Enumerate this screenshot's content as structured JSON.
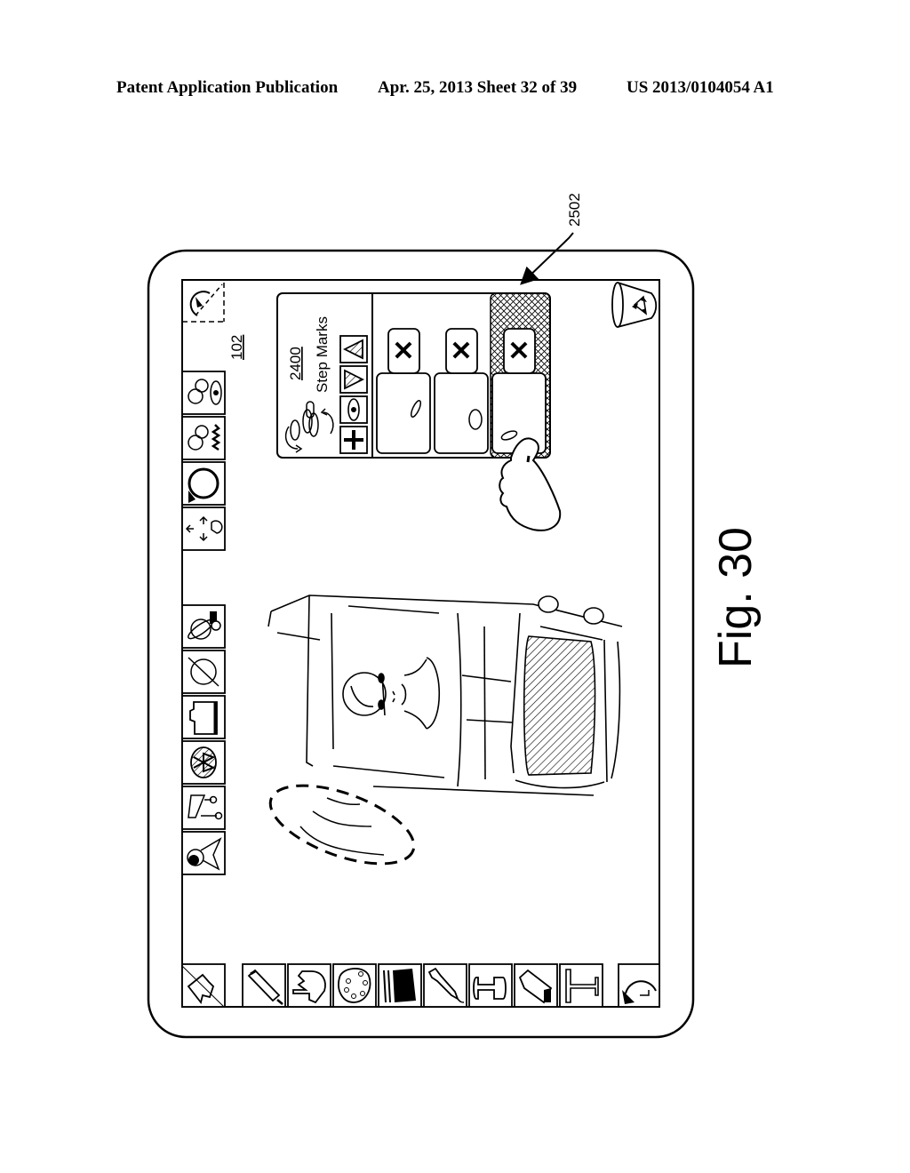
{
  "header": {
    "left": "Patent Application Publication",
    "middle": "Apr. 25, 2013  Sheet 32 of 39",
    "right": "US 2013/0104054 A1"
  },
  "figure": {
    "label": "Fig. 30",
    "device_ref": "102",
    "callout_ref": "2502"
  },
  "step_marks_panel": {
    "ref": "2400",
    "title": "Step Marks",
    "controls": [
      "move-up-icon",
      "move-down-icon",
      "eye-visibility-icon",
      "add-plus-icon"
    ],
    "steps": [
      {
        "delete_label": "✕",
        "selected": false
      },
      {
        "delete_label": "✕",
        "selected": false
      },
      {
        "delete_label": "✕",
        "selected": true
      }
    ]
  },
  "left_toolbar": {
    "top_items": [
      "rotate-corner-icon",
      "chat-eye-icon",
      "chat-crowd-icon",
      "circle-arrow-icon",
      "move-arrows-icon"
    ],
    "bottom_items": [
      "globe-camera-icon",
      "globe-icon",
      "folder-icon",
      "bluetooth-icon",
      "share-link-icon",
      "paint-target-icon"
    ]
  },
  "bottom_toolbar": {
    "items": [
      "ruler-icon",
      "marker-icon",
      "hand-smudge-icon",
      "palette-icon",
      "fill-swatch-icon",
      "eyedropper-icon",
      "stamp-icon",
      "eraser-icon",
      "text-tool-icon",
      "undo-icon"
    ]
  },
  "trash": {
    "icon": "recycle-bin-icon"
  }
}
